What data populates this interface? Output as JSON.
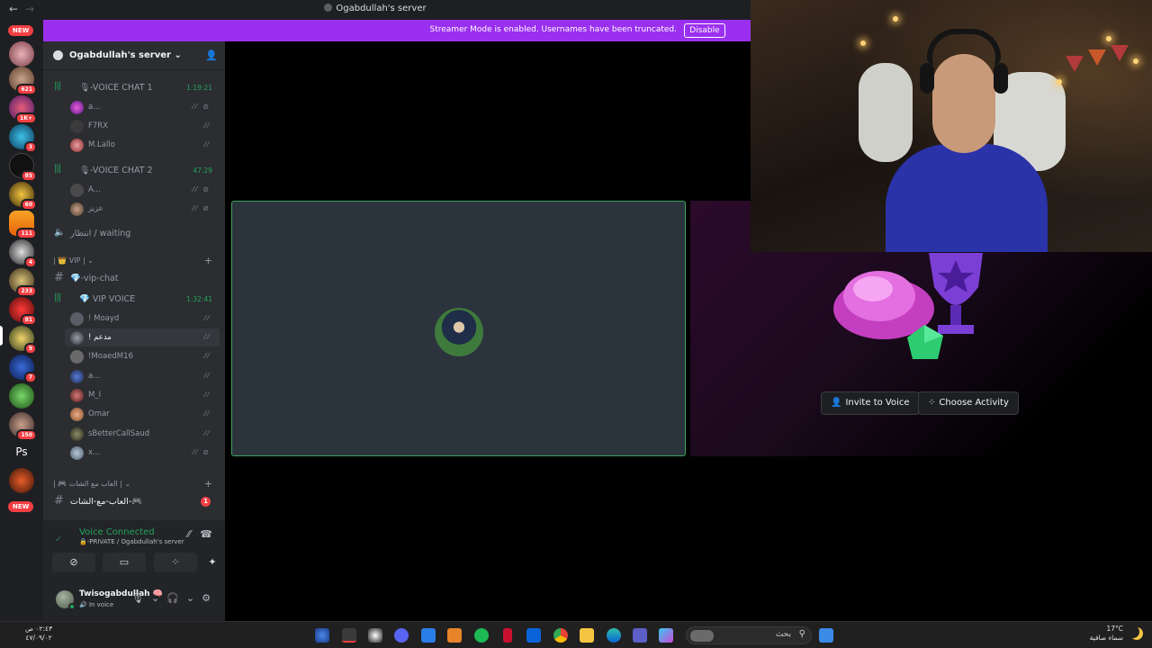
{
  "titlebar": {
    "back": "←",
    "forward": "→",
    "title": "Ogabdullah's server"
  },
  "banner": {
    "text": "Streamer Mode is enabled. Usernames have been truncated.",
    "button": "Disable"
  },
  "rail": {
    "new_top": "NEW",
    "new_bottom": "NEW",
    "counts": [
      "621",
      "1K+",
      "3",
      "85",
      "60",
      "111",
      "4",
      "233",
      "81",
      "9",
      "7",
      "150"
    ],
    "ps_label": "Ps"
  },
  "server": {
    "name": "Ogabdullah's server ⌄"
  },
  "channels": {
    "voice1": {
      "label": "🎙-VOICE CHAT 1",
      "time": "1:19:21"
    },
    "voice1_users": [
      "a...",
      "F7RX",
      "M.Lallo"
    ],
    "voice2": {
      "label": "🎙-VOICE CHAT 2",
      "time": "47:29"
    },
    "voice2_users": [
      "A...",
      "عزيز"
    ],
    "waiting": "انتظار / waiting",
    "vip_cat": "| 👑 VIP | ⌄",
    "vip_chat": "💎-vip-chat",
    "vip_voice": {
      "label": "💎 VIP VOICE",
      "time": "1:32:41"
    },
    "vip_users": [
      "! Moayd",
      "! مدعم",
      "!MoaedM16",
      "a...",
      "M_I",
      "Omar",
      "sBetterCallSaud",
      "x..."
    ],
    "games_cat": "| 🎮 العاب مع الشات | ⌄",
    "games_chat": "العاب-مع-الشات-🎮",
    "games_badge": "1"
  },
  "voice_panel": {
    "title": "Voice Connected",
    "subtitle": "🔒-PRIVATE / Ogabdullah's server"
  },
  "user": {
    "name": "Twisogabdullah",
    "emoji": "🧠",
    "status": "🔊 In voice"
  },
  "activity": {
    "invite": "Invite to Voice",
    "choose": "Choose Activity"
  },
  "taskbar": {
    "search": "بحث",
    "time": "٠٢:٤٣ ص",
    "date": "٤٧/٠٩/٠٢",
    "temp": "17°C",
    "weather": "سماء صافية"
  }
}
